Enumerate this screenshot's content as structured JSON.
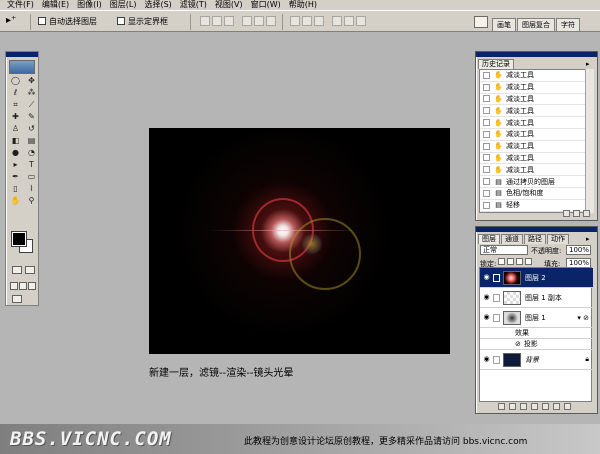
{
  "menu": [
    "文件(F)",
    "编辑(E)",
    "图像(I)",
    "图层(L)",
    "选择(S)",
    "滤镜(T)",
    "视图(V)",
    "窗口(W)",
    "帮助(H)"
  ],
  "options": {
    "auto_select_label": "自动选择图层",
    "show_bounds_label": "显示定界框"
  },
  "palette_well_tabs": [
    "画笔",
    "图层复合",
    "字符"
  ],
  "history": {
    "tab": "历史记录",
    "items": [
      "减淡工具",
      "减淡工具",
      "减淡工具",
      "减淡工具",
      "减淡工具",
      "减淡工具",
      "减淡工具",
      "减淡工具",
      "减淡工具",
      "通过拷贝的图层",
      "色相/饱和度",
      "轻移",
      "轻移"
    ]
  },
  "layers": {
    "tabs": [
      "图层",
      "通道",
      "路径",
      "动作"
    ],
    "mode": "正常",
    "opacity_label": "不透明度:",
    "opacity_value": "100%",
    "lock_label": "锁定:",
    "fill_label": "填充:",
    "fill_value": "100%",
    "items": [
      {
        "name": "图层 2",
        "selected": true
      },
      {
        "name": "图层 1 副本"
      },
      {
        "name": "图层 1"
      },
      {
        "name": "效果"
      },
      {
        "name": "投影"
      },
      {
        "name": "背景"
      }
    ]
  },
  "caption": "新建一层，滤镜--渲染--镜头光晕",
  "watermark": {
    "logo": "BBS.VICNC.COM",
    "text": "此教程为创意设计论坛原创教程，更多精采作品请访问 bbs.vicnc.com"
  },
  "colors": {
    "foreground": "#000000",
    "background": "#ffffff"
  }
}
